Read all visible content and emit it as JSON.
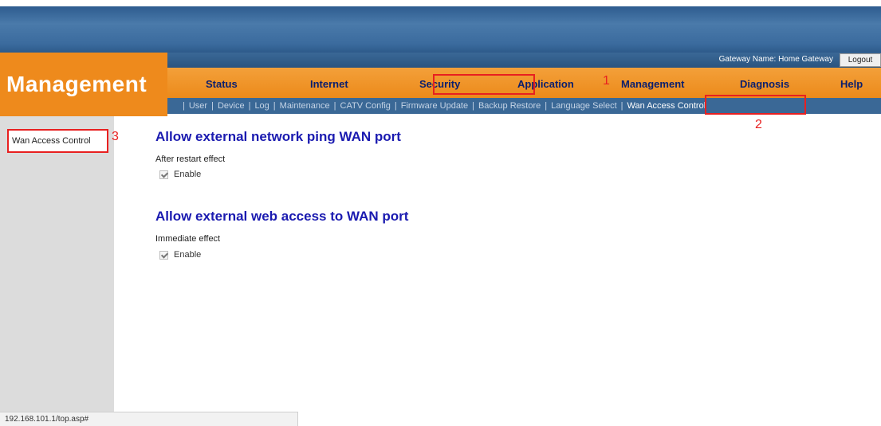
{
  "header": {
    "page_title": "Management",
    "gateway_name": "Gateway Name: Home Gateway",
    "logout_label": "Logout"
  },
  "main_nav": {
    "items": [
      {
        "label": "Status"
      },
      {
        "label": "Internet"
      },
      {
        "label": "Security"
      },
      {
        "label": "Application"
      },
      {
        "label": "Management",
        "active": true
      },
      {
        "label": "Diagnosis"
      },
      {
        "label": "Help"
      }
    ]
  },
  "sub_nav": {
    "items": [
      {
        "label": "User"
      },
      {
        "label": "Device"
      },
      {
        "label": "Log"
      },
      {
        "label": "Maintenance"
      },
      {
        "label": "CATV Config"
      },
      {
        "label": "Firmware Update"
      },
      {
        "label": "Backup Restore"
      },
      {
        "label": "Language Select"
      },
      {
        "label": "Wan Access Control",
        "active": true
      }
    ],
    "separator": "|"
  },
  "annotations": {
    "one": "1",
    "two": "2",
    "three": "3",
    "color": "#e82020"
  },
  "sidebar": {
    "items": [
      {
        "label": "Wan Access Control"
      }
    ]
  },
  "content": {
    "sections": [
      {
        "title": "Allow external network ping WAN port",
        "effect": "After restart effect",
        "enable_label": "Enable",
        "checked": true
      },
      {
        "title": "Allow external web access to WAN port",
        "effect": "Immediate effect",
        "enable_label": "Enable",
        "checked": true
      }
    ]
  },
  "status_bar": {
    "url": "192.168.101.1/top.asp#"
  },
  "colors": {
    "orange": "#ee8a1c",
    "navy_blue": "#3a6896",
    "title_blue": "#1a1ab0",
    "nav_text": "#0a1e6e"
  }
}
